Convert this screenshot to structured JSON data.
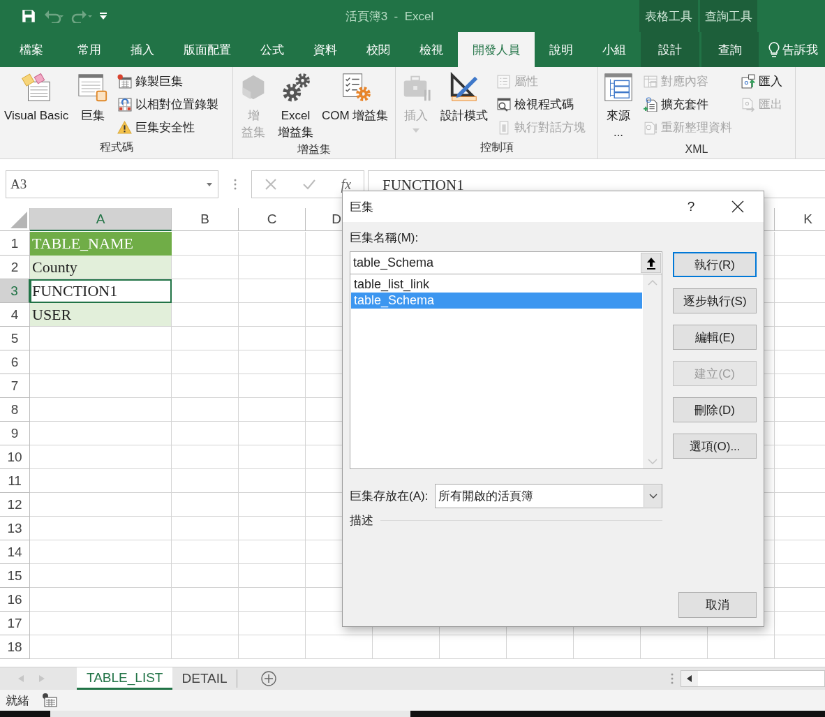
{
  "window": {
    "title": "活頁簿3  -  Excel"
  },
  "context_tabs": [
    {
      "label": "表格工具"
    },
    {
      "label": "查詢工具"
    }
  ],
  "ribbon_tabs": [
    {
      "label": "檔案",
      "selected": false,
      "contextual": false
    },
    {
      "label": "常用",
      "selected": false,
      "contextual": false
    },
    {
      "label": "插入",
      "selected": false,
      "contextual": false
    },
    {
      "label": "版面配置",
      "selected": false,
      "contextual": false
    },
    {
      "label": "公式",
      "selected": false,
      "contextual": false
    },
    {
      "label": "資料",
      "selected": false,
      "contextual": false
    },
    {
      "label": "校閱",
      "selected": false,
      "contextual": false
    },
    {
      "label": "檢視",
      "selected": false,
      "contextual": false
    },
    {
      "label": "開發人員",
      "selected": true,
      "contextual": false
    },
    {
      "label": "說明",
      "selected": false,
      "contextual": false
    },
    {
      "label": "小組",
      "selected": false,
      "contextual": false
    },
    {
      "label": "設計",
      "selected": false,
      "contextual": true
    },
    {
      "label": "查詢",
      "selected": false,
      "contextual": true
    }
  ],
  "tell_me": {
    "label": "告訴我"
  },
  "ribbon_groups": [
    {
      "label": "程式碼",
      "items": [
        {
          "kind": "large",
          "lines": [
            "Visual Basic"
          ],
          "disabled": false
        },
        {
          "kind": "large",
          "lines": [
            "巨集"
          ],
          "disabled": false
        },
        {
          "kind": "stack",
          "buttons": [
            {
              "label": "錄製巨集",
              "disabled": false
            },
            {
              "label": "以相對位置錄製",
              "disabled": false
            },
            {
              "label": "巨集安全性",
              "disabled": false
            }
          ]
        }
      ]
    },
    {
      "label": "增益集",
      "items": [
        {
          "kind": "large",
          "lines": [
            "增",
            "益集"
          ],
          "disabled": true
        },
        {
          "kind": "large",
          "lines": [
            "Excel",
            "增益集"
          ],
          "disabled": false
        },
        {
          "kind": "large",
          "lines": [
            "COM 增益集"
          ],
          "disabled": false
        }
      ]
    },
    {
      "label": "控制項",
      "items": [
        {
          "kind": "large",
          "lines": [
            "插入"
          ],
          "disabled": true,
          "has_menu": true
        },
        {
          "kind": "large",
          "lines": [
            "設計模式"
          ],
          "disabled": false
        },
        {
          "kind": "stack",
          "buttons": [
            {
              "label": "屬性",
              "disabled": true
            },
            {
              "label": "檢視程式碼",
              "disabled": false
            },
            {
              "label": "執行對話方塊",
              "disabled": true
            }
          ]
        }
      ]
    },
    {
      "label": "XML",
      "items": [
        {
          "kind": "large",
          "lines": [
            "來源",
            "..."
          ],
          "disabled": false
        },
        {
          "kind": "stack",
          "buttons": [
            {
              "label": "對應內容",
              "disabled": true
            },
            {
              "label": "擴充套件",
              "disabled": false
            },
            {
              "label": "重新整理資料",
              "disabled": true
            }
          ]
        },
        {
          "kind": "stack",
          "buttons": [
            {
              "label": "匯入",
              "disabled": false
            },
            {
              "label": "匯出",
              "disabled": true
            }
          ]
        }
      ]
    }
  ],
  "name_box": {
    "value": "A3"
  },
  "formula_bar": {
    "function_button": "fx",
    "value": "FUNCTION1"
  },
  "columns": [
    {
      "label": "A",
      "selected": true
    },
    {
      "label": "B",
      "selected": false
    },
    {
      "label": "C",
      "selected": false
    },
    {
      "label": "D",
      "selected": false
    },
    {
      "label": "K",
      "selected": false
    }
  ],
  "rows": [
    {
      "label": "1",
      "selected": false,
      "cells": [
        {
          "value": "TABLE_NAME",
          "kind": "table_header",
          "selected": false
        }
      ]
    },
    {
      "label": "2",
      "selected": false,
      "cells": [
        {
          "value": "County",
          "kind": "table_band",
          "selected": false
        }
      ]
    },
    {
      "label": "3",
      "selected": true,
      "cells": [
        {
          "value": "FUNCTION1",
          "kind": "table_row",
          "selected": true
        }
      ]
    },
    {
      "label": "4",
      "selected": false,
      "cells": [
        {
          "value": "USER",
          "kind": "table_band",
          "selected": false
        }
      ]
    },
    {
      "label": "5",
      "selected": false
    },
    {
      "label": "6",
      "selected": false
    },
    {
      "label": "7",
      "selected": false
    },
    {
      "label": "8",
      "selected": false
    },
    {
      "label": "9",
      "selected": false
    },
    {
      "label": "10",
      "selected": false
    },
    {
      "label": "11",
      "selected": false
    },
    {
      "label": "12",
      "selected": false
    },
    {
      "label": "13",
      "selected": false
    },
    {
      "label": "14",
      "selected": false
    },
    {
      "label": "15",
      "selected": false
    },
    {
      "label": "16",
      "selected": false
    },
    {
      "label": "17",
      "selected": false
    },
    {
      "label": "18",
      "selected": false
    }
  ],
  "sheet_tabs": [
    {
      "label": "TABLE_LIST",
      "selected": true
    },
    {
      "label": "DETAIL",
      "selected": false
    }
  ],
  "status_bar": {
    "text": "就緒"
  },
  "dialog": {
    "title": "巨集",
    "help": "?",
    "name_label": "巨集名稱(M):",
    "name_value": "table_Schema",
    "macros": [
      {
        "name": "table_list_link",
        "selected": false
      },
      {
        "name": "table_Schema",
        "selected": true
      }
    ],
    "buttons": [
      {
        "label": "執行(R)",
        "default": true,
        "disabled": false
      },
      {
        "label": "逐步執行(S)",
        "default": false,
        "disabled": false
      },
      {
        "label": "編輯(E)",
        "default": false,
        "disabled": false
      },
      {
        "label": "建立(C)",
        "default": false,
        "disabled": true
      },
      {
        "label": "刪除(D)",
        "default": false,
        "disabled": false
      },
      {
        "label": "選項(O)...",
        "default": false,
        "disabled": false
      }
    ],
    "location_label": "巨集存放在(A):",
    "location_value": "所有開啟的活頁簿",
    "description_label": "描述",
    "cancel": "取消"
  }
}
